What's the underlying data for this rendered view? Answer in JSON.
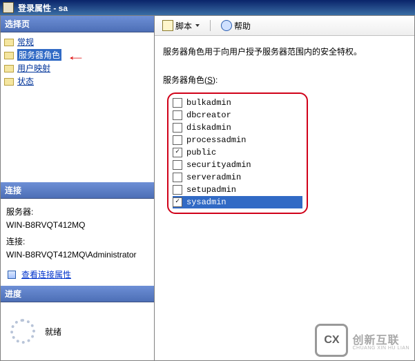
{
  "window": {
    "title": "登录属性 - sa"
  },
  "left": {
    "select_header": "选择页",
    "nav": {
      "general": "常规",
      "server_roles": "服务器角色",
      "user_mapping": "用户映射",
      "status": "状态"
    },
    "connection_header": "连接",
    "server_label": "服务器:",
    "server_value": "WIN-B8RVQT412MQ",
    "conn_label": "连接:",
    "conn_value": "WIN-B8RVQT412MQ\\Administrator",
    "view_conn_link": "查看连接属性",
    "progress_header": "进度",
    "progress_status": "就绪"
  },
  "toolbar": {
    "script": "脚本",
    "help": "帮助"
  },
  "body": {
    "description": "服务器角色用于向用户授予服务器范围内的安全特权。",
    "roles_label": "服务器角色(S):"
  },
  "roles": {
    "bulkadmin": {
      "label": "bulkadmin",
      "checked": false
    },
    "dbcreator": {
      "label": "dbcreator",
      "checked": false
    },
    "diskadmin": {
      "label": "diskadmin",
      "checked": false
    },
    "processadmin": {
      "label": "processadmin",
      "checked": false
    },
    "public": {
      "label": "public",
      "checked": true
    },
    "securityadmin": {
      "label": "securityadmin",
      "checked": false
    },
    "serveradmin": {
      "label": "serveradmin",
      "checked": false
    },
    "setupadmin": {
      "label": "setupadmin",
      "checked": false
    },
    "sysadmin": {
      "label": "sysadmin",
      "checked": true
    }
  },
  "watermark": {
    "logo": "CX",
    "text": "创新互联",
    "sub": "CHUANG XIN HU LIAN"
  }
}
